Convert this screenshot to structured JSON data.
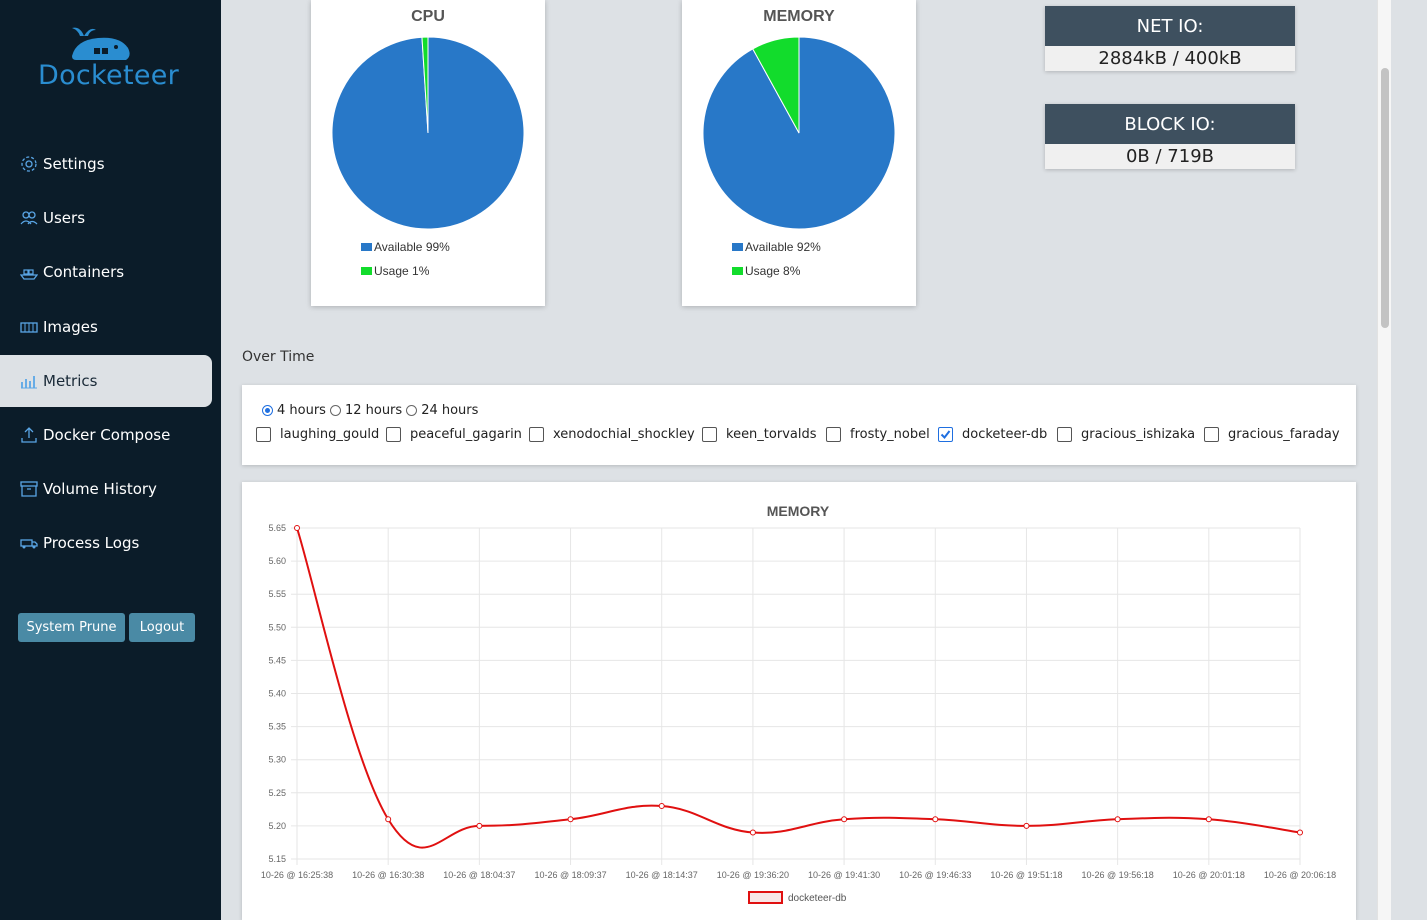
{
  "app": {
    "name": "Docketeer"
  },
  "sidebar": {
    "items": [
      {
        "label": "Settings",
        "icon": "gear-icon",
        "active": false
      },
      {
        "label": "Users",
        "icon": "users-icon",
        "active": false
      },
      {
        "label": "Containers",
        "icon": "ship-icon",
        "active": false
      },
      {
        "label": "Images",
        "icon": "box-icon",
        "active": false
      },
      {
        "label": "Metrics",
        "icon": "chart-icon",
        "active": true
      },
      {
        "label": "Docker Compose",
        "icon": "upload-icon",
        "active": false
      },
      {
        "label": "Volume History",
        "icon": "archive-icon",
        "active": false
      },
      {
        "label": "Process Logs",
        "icon": "truck-icon",
        "active": false
      }
    ],
    "buttons": {
      "prune": "System Prune",
      "logout": "Logout"
    }
  },
  "cpu": {
    "title": "CPU",
    "available_label": "Available 99%",
    "usage_label": "Usage 1%",
    "available": 99,
    "usage": 1
  },
  "memory_pie": {
    "title": "MEMORY",
    "available_label": "Available 92%",
    "usage_label": "Usage 8%",
    "available": 92,
    "usage": 8
  },
  "colors": {
    "available": "#2878c8",
    "usage": "#12dc2c",
    "line": "#e01010",
    "sidebar_bg": "#0b1c29",
    "button": "#4a8aa5"
  },
  "net_io": {
    "title": "NET IO:",
    "value": "2884kB / 400kB"
  },
  "block_io": {
    "title": "BLOCK IO:",
    "value": "0B / 719B"
  },
  "over_time": {
    "heading": "Over Time"
  },
  "time_ranges": [
    {
      "label": "4 hours",
      "selected": true
    },
    {
      "label": "12 hours",
      "selected": false
    },
    {
      "label": "24 hours",
      "selected": false
    }
  ],
  "containers": [
    {
      "name": "laughing_gould",
      "checked": false
    },
    {
      "name": "peaceful_gagarin",
      "checked": false
    },
    {
      "name": "xenodochial_shockley",
      "checked": false
    },
    {
      "name": "keen_torvalds",
      "checked": false
    },
    {
      "name": "frosty_nobel",
      "checked": false
    },
    {
      "name": "docketeer-db",
      "checked": true
    },
    {
      "name": "gracious_ishizaka",
      "checked": false
    },
    {
      "name": "gracious_faraday",
      "checked": false
    }
  ],
  "chart_data": {
    "type": "line",
    "title": "MEMORY",
    "xlabel": "",
    "ylabel": "",
    "x": [
      "10-26 @ 16:25:38",
      "10-26 @ 16:30:38",
      "10-26 @ 18:04:37",
      "10-26 @ 18:09:37",
      "10-26 @ 18:14:37",
      "10-26 @ 19:36:20",
      "10-26 @ 19:41:30",
      "10-26 @ 19:46:33",
      "10-26 @ 19:51:18",
      "10-26 @ 19:56:18",
      "10-26 @ 20:01:18",
      "10-26 @ 20:06:18"
    ],
    "series": [
      {
        "name": "docketeer-db",
        "values": [
          5.65,
          5.21,
          5.2,
          5.21,
          5.23,
          5.19,
          5.21,
          5.21,
          5.2,
          5.21,
          5.21,
          5.19
        ]
      }
    ],
    "ylim": [
      5.15,
      5.65
    ],
    "yticks": [
      "5.65",
      "5.60",
      "5.55",
      "5.50",
      "5.45",
      "5.40",
      "5.35",
      "5.30",
      "5.25",
      "5.20",
      "5.15"
    ],
    "grid": true,
    "legend": "bottom"
  }
}
